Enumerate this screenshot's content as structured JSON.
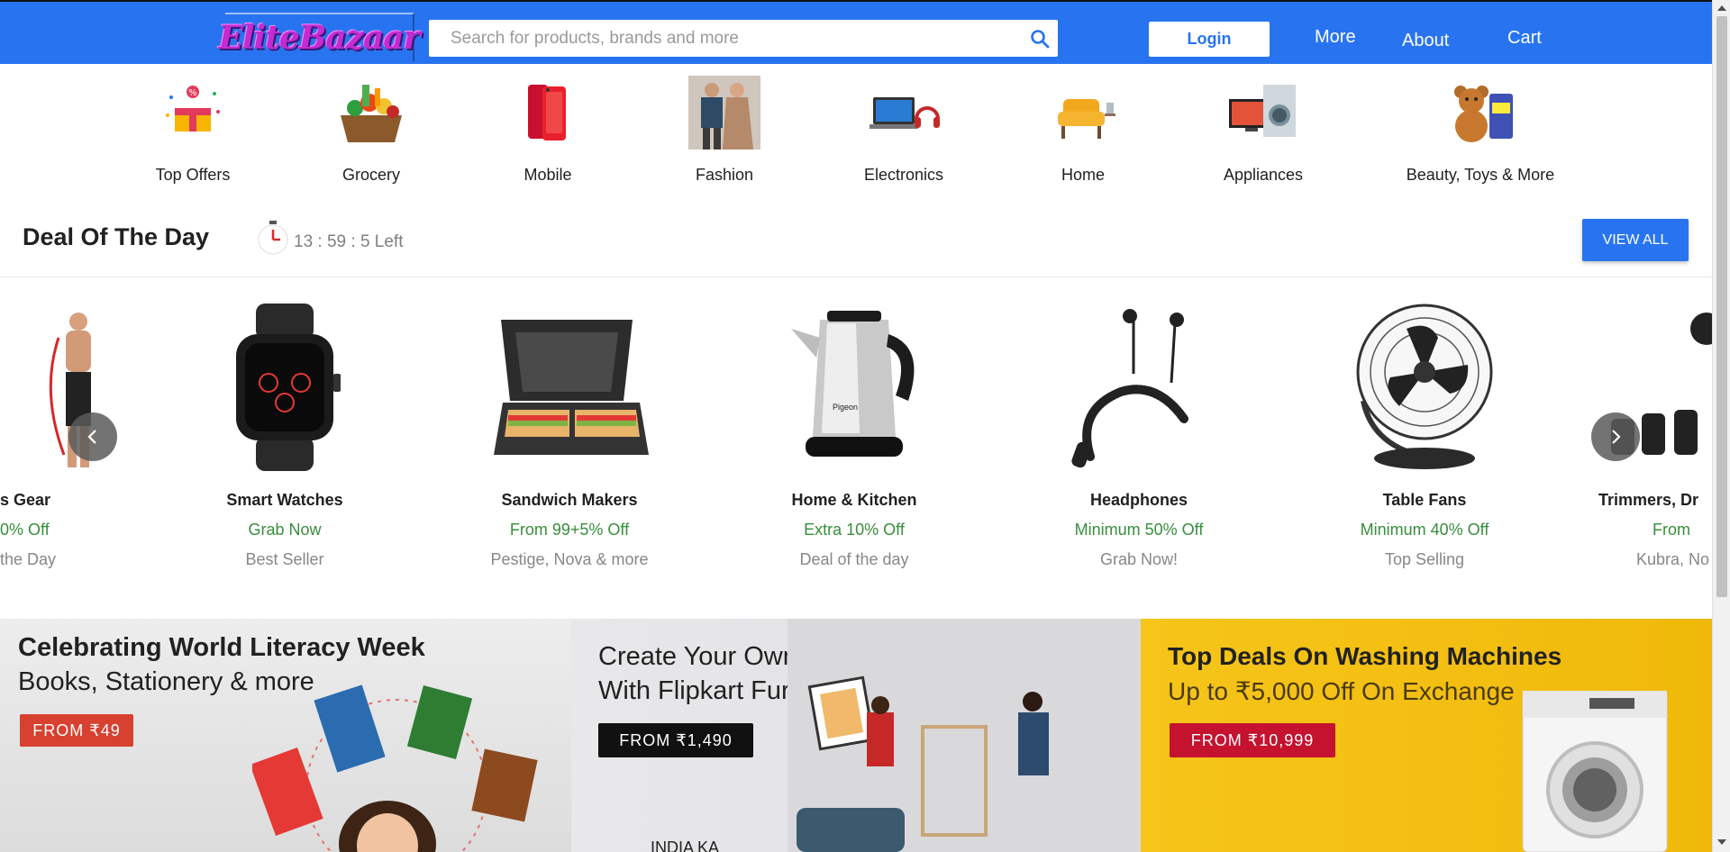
{
  "header": {
    "logo_text": "EliteBazaar",
    "search_placeholder": "Search for products, brands and more",
    "login_label": "Login",
    "nav": [
      "More",
      "About",
      "Cart"
    ]
  },
  "categories": [
    {
      "label": "Top Offers",
      "icon": "gift-box-icon"
    },
    {
      "label": "Grocery",
      "icon": "grocery-basket-icon"
    },
    {
      "label": "Mobile",
      "icon": "smartphone-icon"
    },
    {
      "label": "Fashion",
      "icon": "fashion-couple-icon"
    },
    {
      "label": "Electronics",
      "icon": "laptop-headphones-icon"
    },
    {
      "label": "Home",
      "icon": "armchair-icon"
    },
    {
      "label": "Appliances",
      "icon": "tv-washing-machine-icon"
    },
    {
      "label": "Beauty, Toys & More",
      "icon": "teddy-bear-icon"
    }
  ],
  "deal": {
    "title": "Deal Of The Day",
    "timer": "13 : 59 : 5 Left",
    "view_all": "VIEW ALL"
  },
  "products": [
    {
      "name": "s Gear",
      "offer": "0% Off",
      "sub": "the Day",
      "icon": "fitness-man-icon"
    },
    {
      "name": "Smart Watches",
      "offer": "Grab Now",
      "sub": "Best Seller",
      "icon": "smartwatch-icon"
    },
    {
      "name": "Sandwich Makers",
      "offer": "From 99+5% Off",
      "sub": "Pestige, Nova & more",
      "icon": "sandwich-maker-icon"
    },
    {
      "name": "Home & Kitchen",
      "offer": "Extra 10% Off",
      "sub": "Deal of the day",
      "icon": "kettle-icon"
    },
    {
      "name": "Headphones",
      "offer": "Minimum 50% Off",
      "sub": "Grab Now!",
      "icon": "neckband-headphones-icon"
    },
    {
      "name": "Table Fans",
      "offer": "Minimum 40% Off",
      "sub": "Top Selling",
      "icon": "table-fan-icon"
    },
    {
      "name": "Trimmers, Dr",
      "offer": "From",
      "sub": "Kubra, No",
      "icon": "trimmer-icon"
    }
  ],
  "kettle_brand": "Pigeon",
  "banners": [
    {
      "title": "Celebrating World Literacy Week",
      "subtitle": "Books, Stationery & more",
      "tag": "FROM ₹49"
    },
    {
      "title": "Create Your Own Space",
      "subtitle": "With Flipkart Furniture",
      "tag": "FROM ₹1,490",
      "footer": "INDIA KA"
    },
    {
      "title": "Top Deals On Washing Machines",
      "subtitle": "Up to ₹5,000 Off On Exchange",
      "tag": "FROM ₹10,999"
    }
  ],
  "colors": {
    "brand": "#2874f0",
    "offer_green": "#388e3c",
    "tag_red": "#d8402f",
    "tag_dark": "#111111",
    "tag_crimson": "#c4122f"
  }
}
